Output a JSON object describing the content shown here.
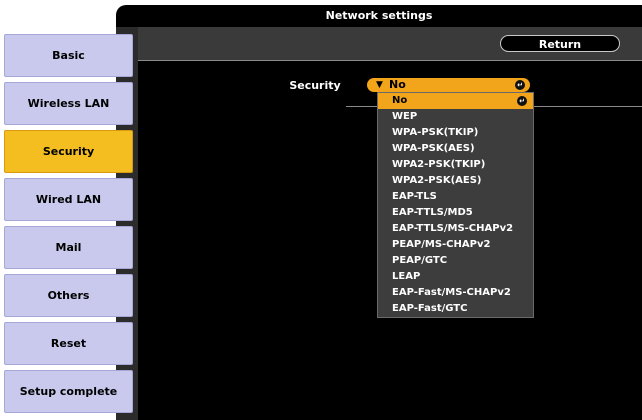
{
  "window": {
    "title": "Network settings"
  },
  "toolbar": {
    "return_label": "Return"
  },
  "sidebar": {
    "items": [
      {
        "label": "Basic",
        "active": false
      },
      {
        "label": "Wireless LAN",
        "active": false
      },
      {
        "label": "Security",
        "active": true
      },
      {
        "label": "Wired LAN",
        "active": false
      },
      {
        "label": "Mail",
        "active": false
      },
      {
        "label": "Others",
        "active": false
      },
      {
        "label": "Reset",
        "active": false
      },
      {
        "label": "Setup complete",
        "active": false
      }
    ]
  },
  "security": {
    "label": "Security",
    "selected": "No",
    "options": [
      "No",
      "WEP",
      "WPA-PSK(TKIP)",
      "WPA-PSK(AES)",
      "WPA2-PSK(TKIP)",
      "WPA2-PSK(AES)",
      "EAP-TLS",
      "EAP-TTLS/MD5",
      "EAP-TTLS/MS-CHAPv2",
      "PEAP/MS-CHAPv2",
      "PEAP/GTC",
      "LEAP",
      "EAP-Fast/MS-CHAPv2",
      "EAP-Fast/GTC"
    ]
  },
  "colors": {
    "accent": "#f4be21",
    "nav_button": "#c9c9ee",
    "panel": "#000000"
  }
}
